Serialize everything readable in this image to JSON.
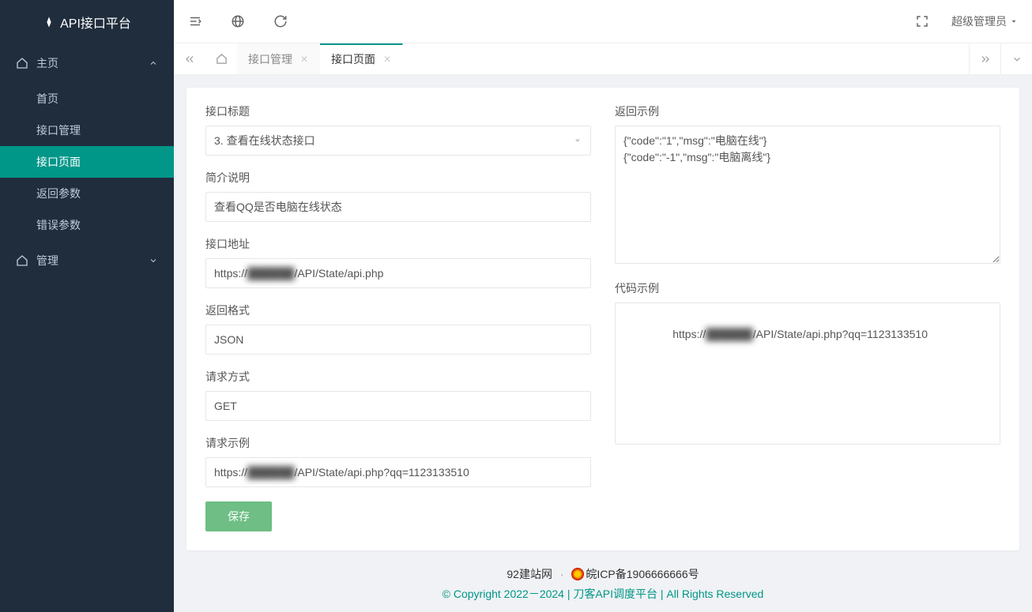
{
  "brand": "API接口平台",
  "sidebar": {
    "groups": [
      {
        "label": "主页",
        "expanded": true,
        "items": [
          "首页",
          "接口管理",
          "接口页面",
          "返回参数",
          "错误参数"
        ],
        "active_index": 2
      },
      {
        "label": "管理",
        "expanded": false
      }
    ]
  },
  "topbar": {
    "user": "超级管理员"
  },
  "tabs": {
    "items": [
      {
        "label": "接口管理",
        "active": false
      },
      {
        "label": "接口页面",
        "active": true
      }
    ]
  },
  "form": {
    "labels": {
      "title": "接口标题",
      "desc": "简介说明",
      "url": "接口地址",
      "format": "返回格式",
      "method": "请求方式",
      "request_example": "请求示例",
      "response_example": "返回示例",
      "code_example": "代码示例"
    },
    "values": {
      "title": "3. 查看在线状态接口",
      "desc": "查看QQ是否电脑在线状态",
      "url_prefix": "https://",
      "url_blurred": "██████",
      "url_suffix": "/API/State/api.php",
      "format": "JSON",
      "method": "GET",
      "request_example_prefix": "https://",
      "request_example_blurred": "██████",
      "request_example_suffix": "/API/State/api.php?qq=1123133510",
      "response_example": "{\"code\":\"1\",\"msg\":\"电脑在线\"}\n{\"code\":\"-1\",\"msg\":\"电脑离线\"}",
      "code_example_prefix": "https://",
      "code_example_blurred": "██████",
      "code_example_suffix": "/API/State/api.php?qq=1123133510"
    },
    "save_label": "保存"
  },
  "footer": {
    "site": "92建站网",
    "icp": "皖ICP备1906666666号",
    "copyright_left": "© Copyright 2022－2024 | ",
    "copyright_mid": "刀客API调度平台",
    "copyright_right": " | All Rights Reserved"
  }
}
